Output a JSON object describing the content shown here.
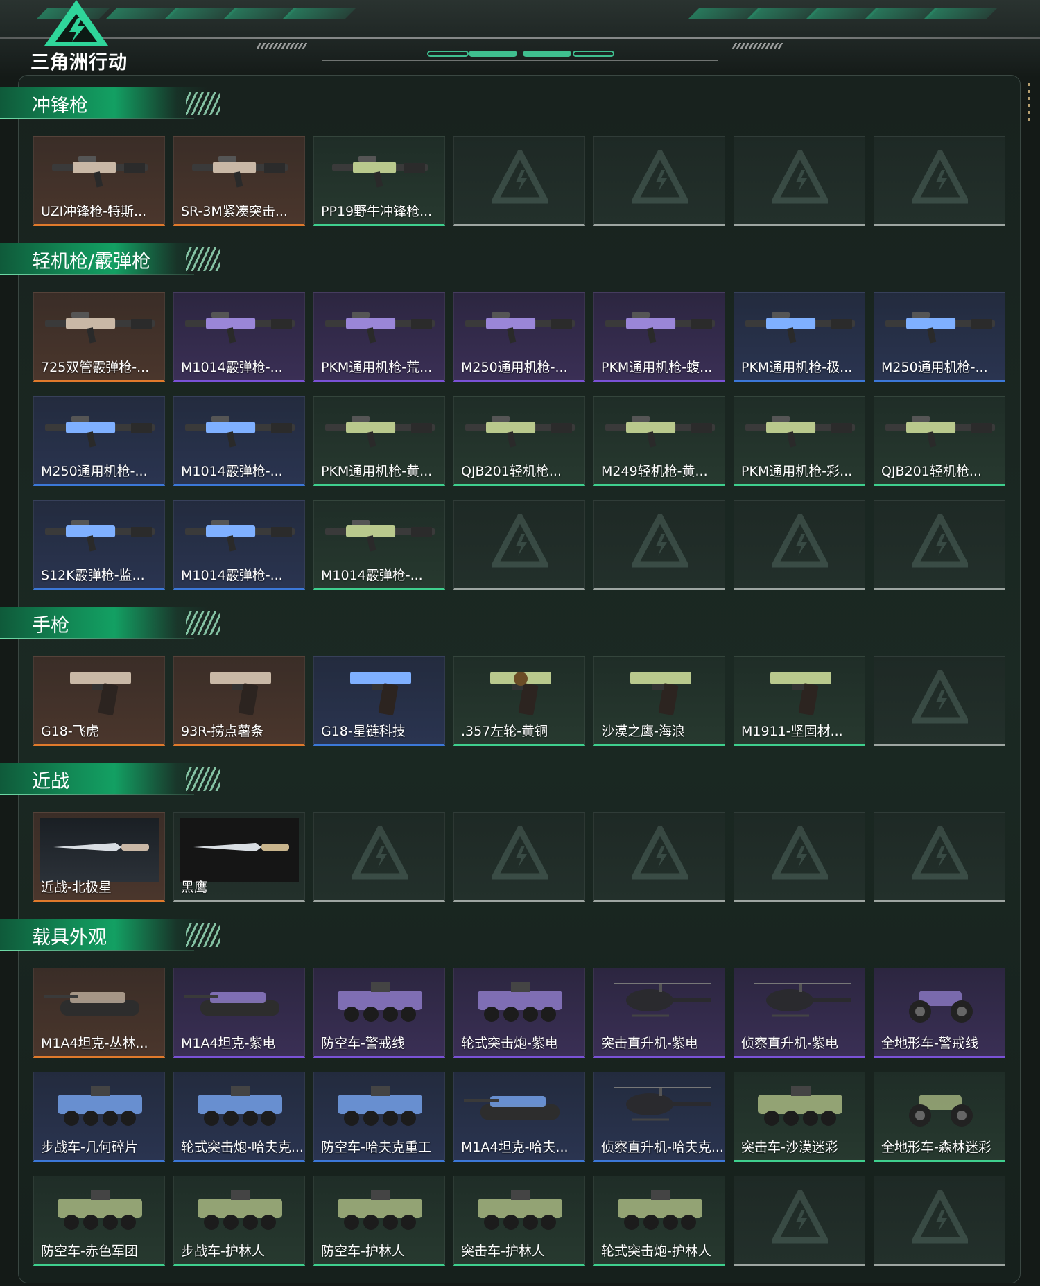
{
  "app": {
    "logo_text": "三角洲行动"
  },
  "sections": [
    {
      "title": "冲锋枪",
      "rows": [
        [
          {
            "name": "UZI冲锋枪-特斯...",
            "rarity": "orange",
            "icon": "smg-icon"
          },
          {
            "name": "SR-3M紧凑突击...",
            "rarity": "orange",
            "icon": "smg-icon"
          },
          {
            "name": "PP19野牛冲锋枪...",
            "rarity": "green",
            "icon": "smg-icon"
          },
          {
            "name": "",
            "rarity": "empty"
          },
          {
            "name": "",
            "rarity": "empty"
          },
          {
            "name": "",
            "rarity": "empty"
          },
          {
            "name": "",
            "rarity": "empty"
          }
        ]
      ]
    },
    {
      "title": "轻机枪/霰弹枪",
      "rows": [
        [
          {
            "name": "725双管霰弹枪-...",
            "rarity": "orange",
            "icon": "shotgun-icon"
          },
          {
            "name": "M1014霰弹枪-...",
            "rarity": "purple",
            "icon": "shotgun-icon"
          },
          {
            "name": "PKM通用机枪-荒...",
            "rarity": "purple",
            "icon": "machinegun-icon"
          },
          {
            "name": "M250通用机枪-...",
            "rarity": "purple",
            "icon": "machinegun-icon"
          },
          {
            "name": "PKM通用机枪-蝮...",
            "rarity": "purple",
            "icon": "machinegun-icon"
          },
          {
            "name": "PKM通用机枪-极...",
            "rarity": "blue",
            "icon": "machinegun-icon"
          },
          {
            "name": "M250通用机枪-...",
            "rarity": "blue",
            "icon": "machinegun-icon"
          }
        ],
        [
          {
            "name": "M250通用机枪-...",
            "rarity": "blue",
            "icon": "machinegun-icon"
          },
          {
            "name": "M1014霰弹枪-...",
            "rarity": "blue",
            "icon": "shotgun-icon"
          },
          {
            "name": "PKM通用机枪-黄...",
            "rarity": "green",
            "icon": "machinegun-icon"
          },
          {
            "name": "QJB201轻机枪...",
            "rarity": "green",
            "icon": "machinegun-icon"
          },
          {
            "name": "M249轻机枪-黄...",
            "rarity": "green",
            "icon": "machinegun-icon"
          },
          {
            "name": "PKM通用机枪-彩...",
            "rarity": "green",
            "icon": "machinegun-icon"
          },
          {
            "name": "QJB201轻机枪...",
            "rarity": "green",
            "icon": "machinegun-icon"
          }
        ],
        [
          {
            "name": "S12K霰弹枪-监...",
            "rarity": "blue",
            "icon": "shotgun-icon"
          },
          {
            "name": "M1014霰弹枪-...",
            "rarity": "blue",
            "icon": "shotgun-icon"
          },
          {
            "name": "M1014霰弹枪-...",
            "rarity": "green",
            "icon": "shotgun-icon"
          },
          {
            "name": "",
            "rarity": "empty"
          },
          {
            "name": "",
            "rarity": "empty"
          },
          {
            "name": "",
            "rarity": "empty"
          },
          {
            "name": "",
            "rarity": "empty"
          }
        ]
      ]
    },
    {
      "title": "手枪",
      "rows": [
        [
          {
            "name": "G18-飞虎",
            "rarity": "orange",
            "icon": "pistol-icon"
          },
          {
            "name": "93R-捞点薯条",
            "rarity": "orange",
            "icon": "pistol-icon"
          },
          {
            "name": "G18-星链科技",
            "rarity": "blue",
            "icon": "pistol-icon"
          },
          {
            "name": ".357左轮-黄铜",
            "rarity": "green",
            "icon": "revolver-icon"
          },
          {
            "name": "沙漠之鹰-海浪",
            "rarity": "green",
            "icon": "pistol-icon"
          },
          {
            "name": "M1911-坚固材...",
            "rarity": "green",
            "icon": "pistol-icon"
          },
          {
            "name": "",
            "rarity": "empty"
          }
        ]
      ]
    },
    {
      "title": "近战",
      "rows": [
        [
          {
            "name": "近战-北极星",
            "rarity": "orange",
            "icon": "knife-icon"
          },
          {
            "name": "黑鹰",
            "rarity": "empty",
            "icon": "knife-icon"
          },
          {
            "name": "",
            "rarity": "empty"
          },
          {
            "name": "",
            "rarity": "empty"
          },
          {
            "name": "",
            "rarity": "empty"
          },
          {
            "name": "",
            "rarity": "empty"
          },
          {
            "name": "",
            "rarity": "empty"
          }
        ]
      ]
    },
    {
      "title": "载具外观",
      "rows": [
        [
          {
            "name": "M1A4坦克-丛林...",
            "rarity": "orange",
            "icon": "tank-icon"
          },
          {
            "name": "M1A4坦克-紫电",
            "rarity": "purple",
            "icon": "tank-icon"
          },
          {
            "name": "防空车-警戒线",
            "rarity": "purple",
            "icon": "apc-icon"
          },
          {
            "name": "轮式突击炮-紫电",
            "rarity": "purple",
            "icon": "armored-car-icon"
          },
          {
            "name": "突击直升机-紫电",
            "rarity": "purple",
            "icon": "helicopter-icon"
          },
          {
            "name": "侦察直升机-紫电",
            "rarity": "purple",
            "icon": "helicopter-icon"
          },
          {
            "name": "全地形车-警戒线",
            "rarity": "purple",
            "icon": "atv-icon"
          }
        ],
        [
          {
            "name": "步战车-几何碎片",
            "rarity": "blue",
            "icon": "apc-icon"
          },
          {
            "name": "轮式突击炮-哈夫克...",
            "rarity": "blue",
            "icon": "armored-car-icon"
          },
          {
            "name": "防空车-哈夫克重工",
            "rarity": "blue",
            "icon": "apc-icon"
          },
          {
            "name": "M1A4坦克-哈夫...",
            "rarity": "blue",
            "icon": "tank-icon"
          },
          {
            "name": "侦察直升机-哈夫克...",
            "rarity": "blue",
            "icon": "helicopter-icon"
          },
          {
            "name": "突击车-沙漠迷彩",
            "rarity": "green",
            "icon": "armored-car-icon"
          },
          {
            "name": "全地形车-森林迷彩",
            "rarity": "green",
            "icon": "atv-icon"
          }
        ],
        [
          {
            "name": "防空车-赤色军团",
            "rarity": "green",
            "icon": "apc-icon"
          },
          {
            "name": "步战车-护林人",
            "rarity": "green",
            "icon": "apc-icon"
          },
          {
            "name": "防空车-护林人",
            "rarity": "green",
            "icon": "apc-icon"
          },
          {
            "name": "突击车-护林人",
            "rarity": "green",
            "icon": "armored-car-icon"
          },
          {
            "name": "轮式突击炮-护林人",
            "rarity": "green",
            "icon": "armored-car-icon"
          },
          {
            "name": "",
            "rarity": "empty"
          },
          {
            "name": "",
            "rarity": "empty"
          }
        ]
      ]
    }
  ],
  "colors": {
    "orange": "#e07a2c",
    "purple": "#7a52d6",
    "blue": "#3c78d8",
    "green": "#3fcf8e",
    "empty": "#9ea6a2",
    "accent": "#13a063"
  }
}
